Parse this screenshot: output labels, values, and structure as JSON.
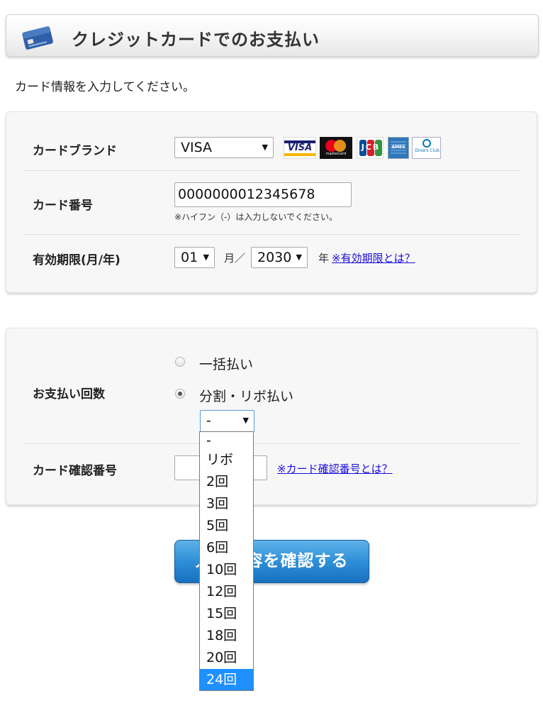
{
  "header": {
    "title": "クレジットカードでのお支払い",
    "icon": "credit-card-icon"
  },
  "intro": "カード情報を入力してください。",
  "card_brand": {
    "label": "カードブランド",
    "selected": "VISA",
    "logos": [
      {
        "name": "visa-logo",
        "text": "VISA"
      },
      {
        "name": "mastercard-logo",
        "text": "mastercard"
      },
      {
        "name": "jcb-logo",
        "text": "JCB"
      },
      {
        "name": "amex-logo",
        "text": "AMEX"
      },
      {
        "name": "diners-logo",
        "text": "Diners Club"
      }
    ]
  },
  "card_number": {
    "label": "カード番号",
    "value": "0000000012345678",
    "note": "※ハイフン（-）は入力しないでください。"
  },
  "expiry": {
    "label": "有効期限(月/年)",
    "month": "01",
    "month_unit": "月／",
    "year": "2030",
    "year_unit": "年",
    "help_link": "※有効期限とは？"
  },
  "payment_count": {
    "label": "お支払い回数",
    "option_lump": "一括払い",
    "option_installment": "分割・リボ払い",
    "selected_option": "installment",
    "installment_value": "-",
    "dropdown_options": [
      "-",
      "リボ",
      "2回",
      "3回",
      "5回",
      "6回",
      "10回",
      "12回",
      "15回",
      "18回",
      "20回",
      "24回"
    ],
    "highlighted_option": "24回"
  },
  "security_code": {
    "label": "カード確認番号",
    "value": "",
    "help_link": "※カード確認番号とは？"
  },
  "confirm_button": "入力内容を確認する",
  "colors": {
    "accent": "#2f8fd6",
    "link": "#1a0dd8",
    "highlight": "#1e90ff"
  }
}
